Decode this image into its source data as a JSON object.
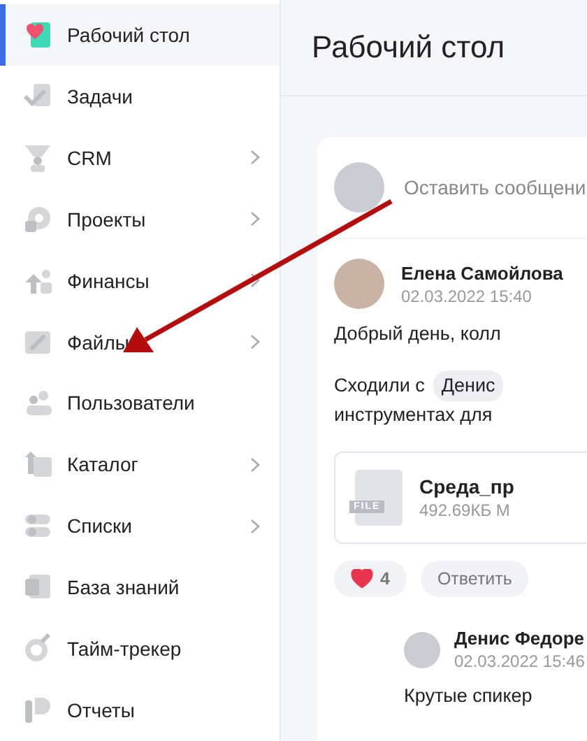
{
  "sidebar": {
    "items": [
      {
        "label": "Рабочий стол",
        "selected": true,
        "expandable": false,
        "kind": "desk"
      },
      {
        "label": "Задачи",
        "selected": false,
        "expandable": false,
        "kind": "tasks"
      },
      {
        "label": "CRM",
        "selected": false,
        "expandable": true,
        "kind": "crm"
      },
      {
        "label": "Проекты",
        "selected": false,
        "expandable": true,
        "kind": "projects"
      },
      {
        "label": "Финансы",
        "selected": false,
        "expandable": true,
        "kind": "finance"
      },
      {
        "label": "Файлы",
        "selected": false,
        "expandable": true,
        "kind": "files"
      },
      {
        "label": "Пользователи",
        "selected": false,
        "expandable": false,
        "kind": "users"
      },
      {
        "label": "Каталог",
        "selected": false,
        "expandable": true,
        "kind": "catalog"
      },
      {
        "label": "Списки",
        "selected": false,
        "expandable": true,
        "kind": "lists"
      },
      {
        "label": "База знаний",
        "selected": false,
        "expandable": false,
        "kind": "kb"
      },
      {
        "label": "Тайм-трекер",
        "selected": false,
        "expandable": false,
        "kind": "timer"
      },
      {
        "label": "Отчеты",
        "selected": false,
        "expandable": false,
        "kind": "reports"
      }
    ]
  },
  "header": {
    "title": "Рабочий стол"
  },
  "composer": {
    "placeholder": "Оставить сообщени"
  },
  "post": {
    "author": "Елена Самойлова",
    "time": "02.03.2022 15:40",
    "greeting": "Добрый день, колл",
    "line_start": "Сходили с",
    "mention": "Денис",
    "line_end": "инструментах для",
    "file": {
      "badge": "FILE",
      "name": "Среда_пр",
      "size": "492.69КБ М"
    },
    "likes": {
      "count": "4",
      "liked": true
    },
    "reply": "Ответить"
  },
  "comment": {
    "author": "Денис Федоре",
    "time": "02.03.2022 15:46",
    "text": "Крутые спикер"
  }
}
